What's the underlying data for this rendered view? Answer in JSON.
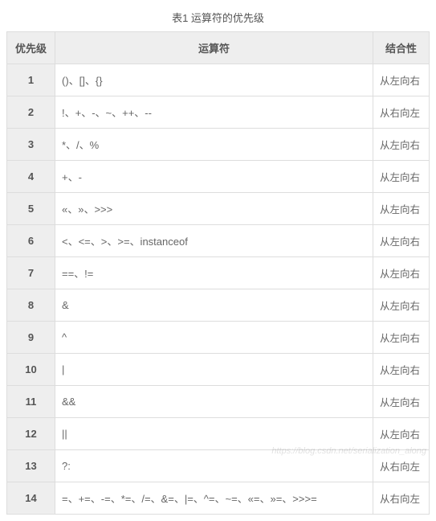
{
  "title": "表1 运算符的优先级",
  "headers": {
    "priority": "优先级",
    "operator": "运算符",
    "assoc": "结合性"
  },
  "rows": [
    {
      "priority": "1",
      "ops": "()、[]、{}",
      "assoc": "从左向右"
    },
    {
      "priority": "2",
      "ops": "!、+、-、~、++、--",
      "assoc": "从右向左"
    },
    {
      "priority": "3",
      "ops": "*、/、%",
      "assoc": "从左向右"
    },
    {
      "priority": "4",
      "ops": "+、-",
      "assoc": "从左向右"
    },
    {
      "priority": "5",
      "ops": "«、»、>>>",
      "assoc": "从左向右"
    },
    {
      "priority": "6",
      "ops": "<、<=、>、>=、instanceof",
      "assoc": "从左向右"
    },
    {
      "priority": "7",
      "ops": "==、!=",
      "assoc": "从左向右"
    },
    {
      "priority": "8",
      "ops": "&",
      "assoc": "从左向右"
    },
    {
      "priority": "9",
      "ops": "^",
      "assoc": "从左向右"
    },
    {
      "priority": "10",
      "ops": "|",
      "assoc": "从左向右"
    },
    {
      "priority": "11",
      "ops": "&&",
      "assoc": "从左向右"
    },
    {
      "priority": "12",
      "ops": "||",
      "assoc": "从左向右"
    },
    {
      "priority": "13",
      "ops": "?:",
      "assoc": "从右向左"
    },
    {
      "priority": "14",
      "ops": "=、+=、-=、*=、/=、&=、|=、^=、~=、«=、»=、>>>=",
      "assoc": "从右向左"
    }
  ],
  "watermark": "https://blog.csdn.net/serialization_along"
}
